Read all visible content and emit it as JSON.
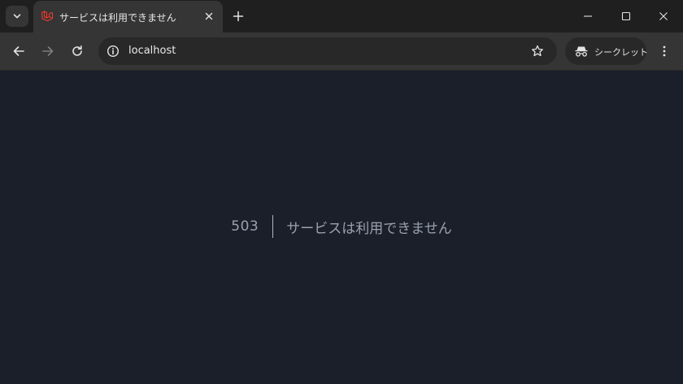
{
  "tab": {
    "title": "サービスは利用できません",
    "favicon": "laravel-icon"
  },
  "address_bar": {
    "url": "localhost"
  },
  "incognito": {
    "label": "シークレット"
  },
  "page": {
    "error_code": "503",
    "error_message": "サービスは利用できません"
  },
  "colors": {
    "page_background": "#1b1f2a",
    "browser_chrome": "#353535",
    "favicon_red": "#ef3b2d",
    "error_text": "#9aa1ad"
  }
}
